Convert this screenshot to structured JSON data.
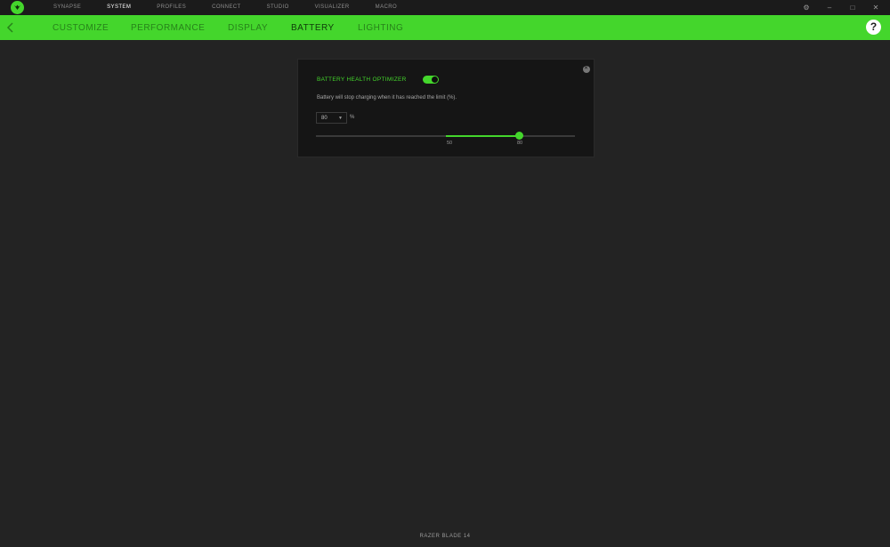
{
  "app": {
    "top_nav": [
      "SYNAPSE",
      "SYSTEM",
      "PROFILES",
      "CONNECT",
      "STUDIO",
      "VISUALIZER",
      "MACRO"
    ],
    "active_top_nav": "SYSTEM",
    "sub_nav": [
      "CUSTOMIZE",
      "PERFORMANCE",
      "DISPLAY",
      "BATTERY",
      "LIGHTING"
    ],
    "active_sub_nav": "BATTERY",
    "help_label": "?",
    "colors": {
      "accent": "#44d62c",
      "background": "#232323",
      "panel": "#151515"
    }
  },
  "battery": {
    "optimizer_label": "BATTERY HEALTH OPTIMIZER",
    "optimizer_enabled": true,
    "description": "Battery will stop charging when it has reached the limit (%).",
    "limit_value": "80",
    "unit": "%",
    "slider": {
      "min": 50,
      "max": 80,
      "min_label": "50",
      "max_label": "80"
    }
  },
  "footer": {
    "device_name": "RAZER BLADE 14"
  }
}
